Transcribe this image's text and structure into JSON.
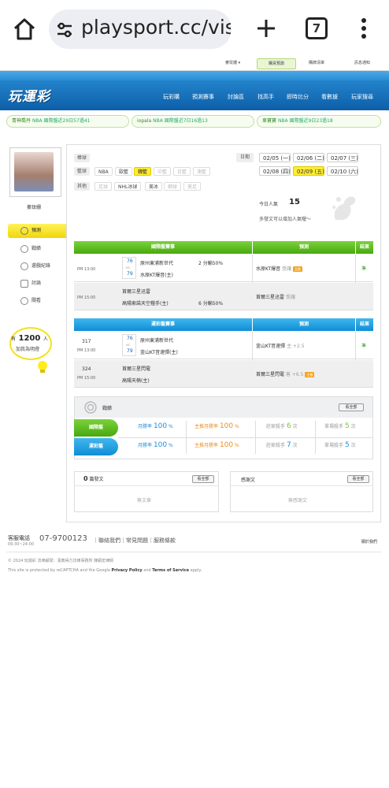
{
  "browser": {
    "url": "playsport.cc/visi",
    "tab_count": "7"
  },
  "topbar": {
    "user": "麥玟姗 ▾",
    "buy": "購買預測",
    "bag": "購牌清單",
    "notice": "訊息通知"
  },
  "header": {
    "logo": "玩運彩",
    "nav": [
      "玩彩購",
      "預測賽事",
      "討論區",
      "找高手",
      "即時比分",
      "看數據",
      "玩家搜尋"
    ]
  },
  "ticker": [
    {
      "user": "青神喬丹",
      "text": "NBA  國際盤近29日57過41"
    },
    {
      "user": "iopala",
      "text": "NBA  國際盤近7日16過13"
    },
    {
      "user": "車寶寶",
      "text": "NBA  國際盤近9日23過18"
    }
  ],
  "sidebar": {
    "username": "麥玟姗",
    "items": [
      "預測",
      "戰績",
      "還戲紀錄",
      "討論",
      "關看"
    ],
    "fans_prefix": "有",
    "fans_count": "1200",
    "fans_suffix": "人",
    "fans_label": "加我為明燈"
  },
  "filters": {
    "labels": [
      "棒球",
      "籃球",
      "其他"
    ],
    "basketball": [
      "NBA",
      "歐籃",
      "韓籃",
      "中籃",
      "日籃",
      "澳籃"
    ],
    "other": [
      "足球",
      "NHL冰球",
      "美冰",
      "網球",
      "美足"
    ],
    "selected": "韓籃"
  },
  "dates": {
    "label": "日期",
    "items": [
      "02/05 (一)",
      "02/06 (二)",
      "02/07 (三)",
      "02/08 (四)",
      "02/09 (五)",
      "02/10 (六)"
    ],
    "selected": "02/09 (五)"
  },
  "popularity": {
    "label": "今日人氣",
    "value": "15",
    "hint": "多發文可以增加人氣喔～"
  },
  "intl_table": {
    "head_event": "國際盤賽事",
    "head_pred": "預測",
    "head_result": "結果",
    "rows": [
      {
        "time": "PM 13:00",
        "score_a": "76",
        "vs": "vs.",
        "score_b": "79",
        "team_a": "原州東浦新世代",
        "team_b": "水原KT爆音(主)",
        "line": "2 分輸50%",
        "pred": "水原KT爆音",
        "pred_note": "受讓",
        "badge": "主推",
        "result": "準"
      },
      {
        "time": "PM 15:00",
        "team_a": "首爾三星迅雷",
        "team_b": "高陽索諾天空糧手(主)",
        "line": "6 分輸50%",
        "pred": "首爾三星迅雷",
        "pred_note": "受讓",
        "result": ""
      }
    ]
  },
  "lottery_table": {
    "head_event": "運彩盤賽事",
    "head_pred": "預測",
    "head_result": "結果",
    "rows": [
      {
        "num": "317",
        "time": "PM 13:00",
        "score_a": "76",
        "vs": "vs.",
        "score_b": "79",
        "team_a": "原州東浦新世代",
        "team_b": "釜山KT音速彈(主)",
        "pred": "釜山KT音速彈",
        "pred_note": "主 +2.5",
        "result": "準"
      },
      {
        "num": "324",
        "time": "PM 15:00",
        "team_a": "首爾三星閃電",
        "team_b": "高陽天楠(主)",
        "pred": "首爾三星閃電",
        "pred_note": "客 +6.5",
        "badge": "主推",
        "result": ""
      }
    ]
  },
  "record": {
    "title": "戰績",
    "more": "看全部",
    "rows": [
      {
        "tag": "國際盤",
        "month_label": "月勝率",
        "month": "100",
        "main_label": "主推月勝率",
        "main": "100",
        "streak_label": "莊家殺手",
        "streak": "6",
        "single_label": "單場殺手",
        "single": "5",
        "pct": "%",
        "unit": "次"
      },
      {
        "tag": "運彩盤",
        "month_label": "月勝率",
        "month": "100",
        "main_label": "主推月勝率",
        "main": "100",
        "streak_label": "莊家殺手",
        "streak": "7",
        "single_label": "單場殺手",
        "single": "5",
        "pct": "%",
        "unit": "次"
      }
    ]
  },
  "articles": {
    "count": "0",
    "title": "篇發文",
    "more": "看全部",
    "empty": "無文章"
  },
  "thanks": {
    "title": "感謝文",
    "more": "看全部",
    "empty": "無感謝文"
  },
  "footer": {
    "service_label": "客服電話",
    "service_hours": "09:30~24:00",
    "phone": "07-9700123",
    "links": [
      "聯絡我們",
      "常見問題",
      "服務條款"
    ],
    "about": "關於我們",
    "copyright": "© 2024 玩運彩  法律顧問：漢典得力法律事務所 陳穎宏律師",
    "recaptcha": "This site is protected by reCAPTCHA and the Google",
    "privacy": "Privacy Policy",
    "and": "and",
    "terms": "Terms of Service",
    "apply": "apply."
  }
}
